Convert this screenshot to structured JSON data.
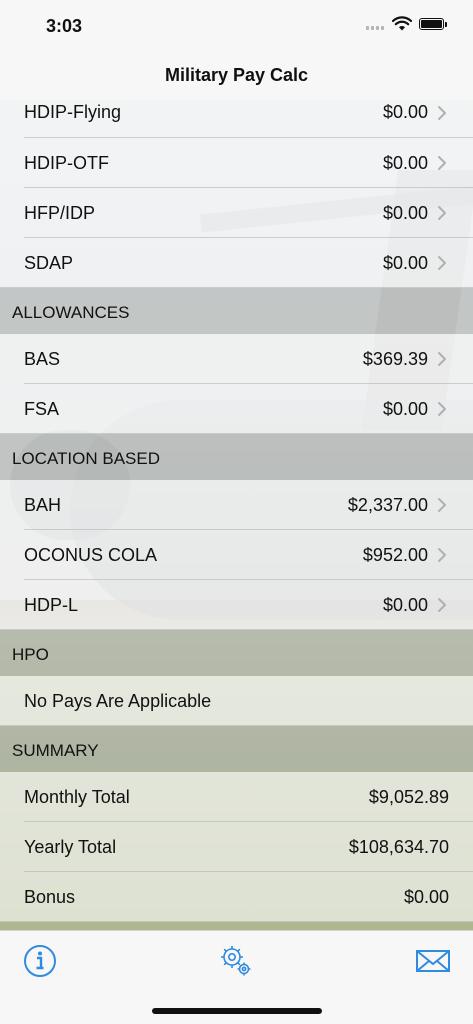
{
  "status_bar": {
    "time": "3:03"
  },
  "nav": {
    "title": "Military Pay Calc"
  },
  "rows_top": [
    {
      "label": "HDIP-Flying",
      "value": "$0.00"
    },
    {
      "label": "HDIP-OTF",
      "value": "$0.00"
    },
    {
      "label": "HFP/IDP",
      "value": "$0.00"
    },
    {
      "label": "SDAP",
      "value": "$0.00"
    }
  ],
  "sections": {
    "allowances": {
      "header": "ALLOWANCES",
      "rows": [
        {
          "label": "BAS",
          "value": "$369.39"
        },
        {
          "label": "FSA",
          "value": "$0.00"
        }
      ]
    },
    "location_based": {
      "header": "LOCATION BASED",
      "rows": [
        {
          "label": "BAH",
          "value": "$2,337.00"
        },
        {
          "label": "OCONUS COLA",
          "value": "$952.00"
        },
        {
          "label": "HDP-L",
          "value": "$0.00"
        }
      ]
    },
    "hpo": {
      "header": "HPO",
      "rows": [
        {
          "label": "No Pays Are Applicable"
        }
      ]
    },
    "summary": {
      "header": "SUMMARY",
      "rows": [
        {
          "label": "Monthly Total",
          "value": "$9,052.89"
        },
        {
          "label": "Yearly Total",
          "value": "$108,634.70"
        },
        {
          "label": "Bonus",
          "value": "$0.00"
        }
      ]
    }
  },
  "tabbar": {
    "info_icon": "info-circle-icon",
    "settings_icon": "gears-icon",
    "mail_icon": "envelope-icon"
  },
  "colors": {
    "accent": "#2f8be0"
  }
}
